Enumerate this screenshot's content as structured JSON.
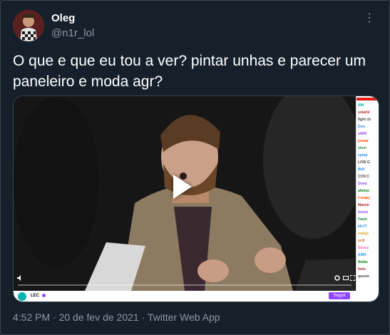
{
  "author": {
    "name": "Oleg",
    "handle": "@n1r_lol"
  },
  "tweet": {
    "text": "O que e que eu tou a ver? pintar unhas e parecer um paneleiro e moda agr?"
  },
  "media": {
    "type": "video",
    "progress_fraction": 0.0,
    "channel_name": "LEC",
    "follow_label": "Seguir",
    "chat_lines": [
      {
        "user": "NW",
        "color": "#00b3b3"
      },
      {
        "user": "solarbl",
        "color": "#b22222"
      },
      {
        "user": "fight ch",
        "color": "#444444"
      },
      {
        "user": "Don",
        "color": "#1e90ff"
      },
      {
        "user": "oWifi",
        "color": "#9147ff"
      },
      {
        "user": "junvar",
        "color": "#ff4500"
      },
      {
        "user": "okon",
        "color": "#2e8b57"
      },
      {
        "user": "sptsp",
        "color": "#1e90ff"
      },
      {
        "user": "LOW G",
        "color": "#444444"
      },
      {
        "user": "Bell",
        "color": "#1e90ff"
      },
      {
        "user": "CCN C",
        "color": "#444444"
      },
      {
        "user": "Dona",
        "color": "#9147ff"
      },
      {
        "user": "ahmss",
        "color": "#008000"
      },
      {
        "user": "Creapy",
        "color": "#ff4500"
      },
      {
        "user": "Marzin",
        "color": "#b22222"
      },
      {
        "user": "boyse",
        "color": "#9147ff"
      },
      {
        "user": "Hawk",
        "color": "#2e8b57"
      },
      {
        "user": "kfc77",
        "color": "#1e90ff"
      },
      {
        "user": "marija",
        "color": "#daa520"
      },
      {
        "user": "ordi",
        "color": "#d2691e"
      },
      {
        "user": "Strass",
        "color": "#ff69b4"
      },
      {
        "user": "AIWI",
        "color": "#1e90ff"
      },
      {
        "user": "thebo",
        "color": "#008000"
      },
      {
        "user": "hoto",
        "color": "#b22222"
      },
      {
        "user": "quesix",
        "color": "#444444"
      }
    ]
  },
  "footer": {
    "time": "4:52 PM",
    "separator": "·",
    "date": "20 de fev de 2021",
    "source": "Twitter Web App"
  },
  "colors": {
    "background": "#15202b",
    "text_primary": "#ffffff",
    "text_secondary": "#8899a6",
    "border": "#38444d",
    "accent": "#1da1f2",
    "twitch_purple": "#9147ff"
  }
}
